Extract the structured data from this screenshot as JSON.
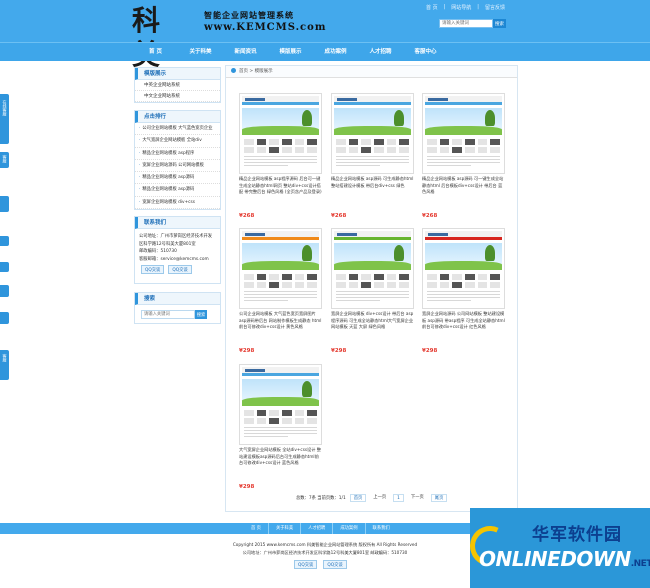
{
  "header": {
    "logo_main": "科 美",
    "logo_tagline": "智能企业网站管理系统",
    "logo_url": "www.KEMCMS.com",
    "top_links": [
      "首 页",
      "|",
      "网站导航",
      "|",
      "留言反馈"
    ],
    "search_placeholder": "请输入关键词",
    "search_button": "搜索"
  },
  "nav": [
    "首 页",
    "关于科美",
    "新闻资讯",
    "模版展示",
    "成功案例",
    "人才招聘",
    "客服中心"
  ],
  "left_tabs": [
    "在线客服",
    "客服",
    "",
    "",
    "",
    "",
    "",
    "客服"
  ],
  "sidebar": {
    "templates": {
      "title": "模版展示",
      "items": [
        "中英企业网站系统",
        "中文企业网站系统"
      ]
    },
    "ranking": {
      "title": "点击排行",
      "items": [
        "公司企业网站模板 大气蓝色宽页企业",
        "大气宽屏企业网站模板 全站div",
        "精品企业网站模板 asp程序",
        "宽屏企业网站源码 公司网站模板",
        "精品企业网站模板 asp源码",
        "精品企业网站模板 asp源码",
        "宽屏企业网站模板 div+css"
      ]
    },
    "contact": {
      "title": "联系我们",
      "lines": [
        "公司地址：广州市萝岗区经济技术开发区科学路12号科美大厦801室",
        "邮政编码：510730",
        "客服邮箱：service@kemcms.com"
      ],
      "qq": [
        "QQ交谈",
        "QQ交谈"
      ]
    },
    "search": {
      "title": "搜索",
      "placeholder": "请输入关键词",
      "button": "搜索"
    }
  },
  "main": {
    "breadcrumb": "首页 > 模版展示",
    "products": [
      {
        "desc": "精品企业网站模板 asp程序源码 后台可一键生成全站静态html网页 整站div+css设计搭配 带完整后台 绿色风格 (全页含产品及登录)",
        "price": "¥268"
      },
      {
        "desc": "精品企业网站模板 asp源码 可生成静态html 整站搭建设计模板 带后台div+css 绿色",
        "price": "¥268"
      },
      {
        "desc": "精品企业网站模板 asp源码 可一键生成全站静态html 后台模板div+css设计 带后台 蓝色风格",
        "price": "¥268"
      },
      {
        "desc": "公司企业网站模板 大气蓝色宽页宽屏图片 asp源码带后台 网站制作模板生成静态 html 前台可修改div+css设计 黄色风格",
        "price": "¥298"
      },
      {
        "desc": "宽屏企业网站模板 div+css设计 带后台 asp程序源码 可生成全站静态html大气宽屏企业网站模板 天蓝 大屏 绿色风格",
        "price": "¥298"
      },
      {
        "desc": "宽屏企业网站源码 公司网站模板 整站建设模板 asp源码 带asp程序 可生成全站静态html前台可修改div+css设计 红色风格",
        "price": "¥298"
      },
      {
        "desc": "大气宽屏企业网站模板 全站div+css设计 整站建设模板asp源码后台可生成静态html前台可修改div+css设计 蓝色风格",
        "price": "¥298"
      }
    ],
    "pager": {
      "summary": "总数：7条 当前页数：1/1",
      "first": "首页",
      "prev": "上一页",
      "current": "1",
      "next": "下一页",
      "last": "尾页"
    }
  },
  "footer": {
    "links": [
      "首 页",
      "关于科美",
      "人才招聘",
      "成功案例",
      "联系我们"
    ],
    "copyright": "Copyright 2015 www.kemcms.com 科美智能企业网站管理系统 版权所有 All Rights Reserved",
    "address": "公司地址：广州市萝岗区经济技术开发区科学路12号科美大厦801室 邮政编码：510730",
    "qq": [
      "QQ交谈",
      "QQ交谈"
    ]
  },
  "watermark": {
    "top": "华军软件园",
    "main": "ONLINEDOWN",
    "suffix": ".NET"
  },
  "colors": {
    "header_blue": "#43a9ec",
    "price_red": "#e4392f",
    "link_blue": "#1e6fb8"
  }
}
